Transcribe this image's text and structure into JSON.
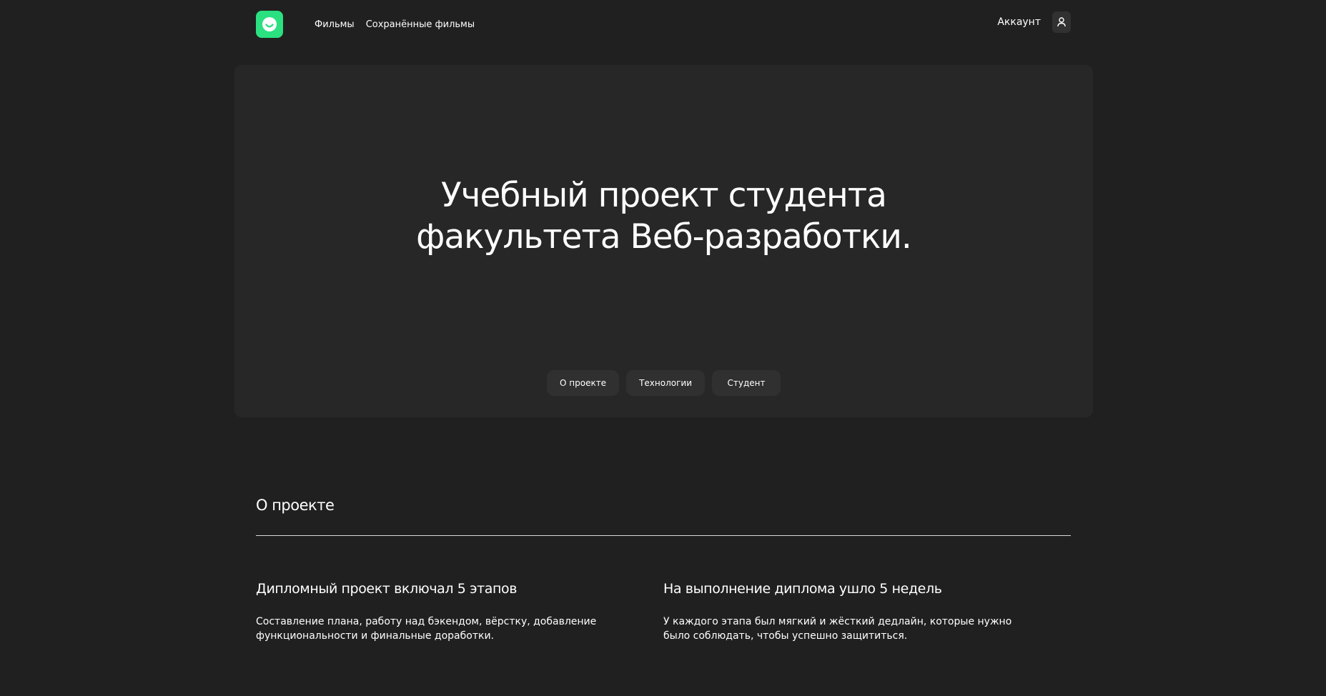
{
  "header": {
    "nav": [
      "Фильмы",
      "Сохранённые фильмы"
    ],
    "account_label": "Аккаунт",
    "logo_icon": "smile-logo-icon",
    "account_icon": "user-icon",
    "accent_color": "#2be080"
  },
  "hero": {
    "title_line1": "Учебный проект студента",
    "title_line2": "факультета Веб-разработки.",
    "nav": [
      "О проекте",
      "Технологии",
      "Студент"
    ]
  },
  "about": {
    "title": "О проекте",
    "columns": [
      {
        "heading": "Дипломный проект включал 5 этапов",
        "text": "Составление плана, работу над бэкендом, вёрстку, добавление функциональности и финальные доработки."
      },
      {
        "heading": "На выполнение диплома ушло 5 недель",
        "text": "У каждого этапа был мягкий и жёсткий дедлайн, которые нужно было соблюдать, чтобы успешно защититься."
      }
    ]
  }
}
